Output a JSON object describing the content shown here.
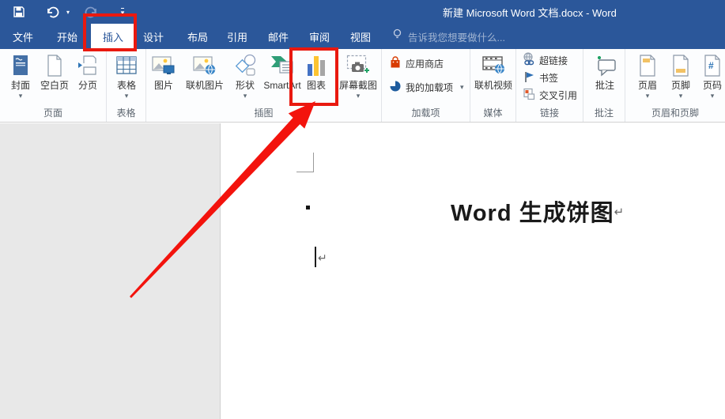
{
  "window": {
    "title": "新建 Microsoft Word 文档.docx - Word"
  },
  "qat": {
    "icons": [
      "save",
      "undo",
      "redo-disabled",
      "customize-quick-access"
    ]
  },
  "tabs": [
    {
      "label": "文件",
      "active": false
    },
    {
      "label": "开始",
      "active": false
    },
    {
      "label": "插入",
      "active": true
    },
    {
      "label": "设计",
      "active": false
    },
    {
      "label": "布局",
      "active": false
    },
    {
      "label": "引用",
      "active": false
    },
    {
      "label": "邮件",
      "active": false
    },
    {
      "label": "审阅",
      "active": false
    },
    {
      "label": "视图",
      "active": false
    }
  ],
  "search": {
    "placeholder": "告诉我您想要做什么...",
    "icon": "lightbulb"
  },
  "ribbon": {
    "groups": [
      {
        "name": "页面",
        "buttons": [
          {
            "label": "封面",
            "icon": "cover-page",
            "caret": true
          },
          {
            "label": "空白页",
            "icon": "blank-page"
          },
          {
            "label": "分页",
            "icon": "page-break"
          }
        ]
      },
      {
        "name": "表格",
        "buttons": [
          {
            "label": "表格",
            "icon": "table",
            "caret": true
          }
        ]
      },
      {
        "name": "插图",
        "buttons": [
          {
            "label": "图片",
            "icon": "picture"
          },
          {
            "label": "联机图片",
            "icon": "online-pictures"
          },
          {
            "label": "形状",
            "icon": "shapes",
            "caret": true
          },
          {
            "label": "SmartArt",
            "icon": "smartart"
          },
          {
            "label": "图表",
            "icon": "chart",
            "highlighted": true
          },
          {
            "label": "屏幕截图",
            "icon": "screenshot",
            "caret": true
          }
        ]
      },
      {
        "name": "加载项",
        "buttons": [
          {
            "label": "应用商店",
            "icon": "store"
          },
          {
            "label": "我的加载项",
            "icon": "my-add-ins",
            "caret": true
          }
        ]
      },
      {
        "name": "媒体",
        "buttons": [
          {
            "label": "联机视频",
            "icon": "online-video"
          }
        ]
      },
      {
        "name": "链接",
        "buttons": [
          {
            "label": "超链接",
            "icon": "hyperlink"
          },
          {
            "label": "书签",
            "icon": "bookmark"
          },
          {
            "label": "交叉引用",
            "icon": "cross-reference"
          }
        ]
      },
      {
        "name": "批注",
        "buttons": [
          {
            "label": "批注",
            "icon": "comment"
          }
        ]
      },
      {
        "name": "页眉和页脚",
        "buttons": [
          {
            "label": "页眉",
            "icon": "header",
            "caret": true
          },
          {
            "label": "页脚",
            "icon": "footer",
            "caret": true
          },
          {
            "label": "页码",
            "icon": "page-number",
            "caret": true
          }
        ]
      }
    ]
  },
  "document": {
    "heading": "Word 生成饼图",
    "paragraph_mark": "↵"
  },
  "annotations": {
    "color": "#e9190f",
    "targets": [
      "insert-tab",
      "chart-button"
    ],
    "arrow": "points-to-chart-button"
  },
  "colors": {
    "titlebar": "#2b579a",
    "active_tab_text": "#2b579a",
    "ribbon_bg": "#fcfdfe",
    "canvas_bg": "#e8e8e8"
  }
}
